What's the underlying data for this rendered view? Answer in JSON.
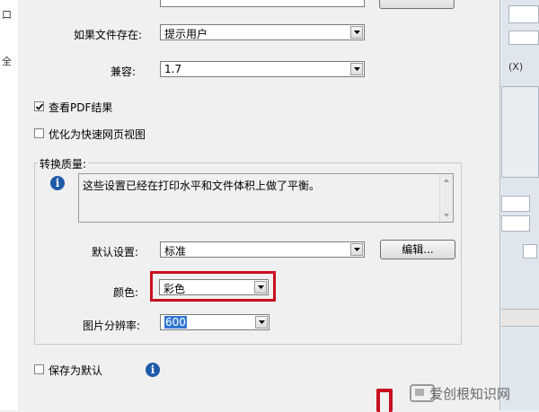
{
  "left_strip": {
    "glyphs": [
      "口",
      "全"
    ]
  },
  "dialog": {
    "if_file_exists": {
      "label": "如果文件存在:",
      "value": "提示用户"
    },
    "compat": {
      "label": "兼容:",
      "value": "1.7"
    },
    "view_pdf": {
      "label": "查看PDF结果",
      "checked": true
    },
    "optimize_web": {
      "label": "优化为快速网页视图",
      "checked": false
    },
    "quality_group": {
      "title": "转换质量:",
      "description": "这些设置已经在打印水平和文件体积上做了平衡。",
      "default_setting": {
        "label": "默认设置:",
        "value": "标准"
      },
      "edit_button": "编辑...",
      "color": {
        "label": "颜色:",
        "value": "彩色"
      },
      "resolution": {
        "label": "图片分辨率:",
        "value": "600"
      }
    },
    "save_default": {
      "label": "保存为默认",
      "checked": false
    }
  },
  "right_strip": {
    "fragment": "(X)"
  },
  "watermark": "爱创根知识网",
  "colors": {
    "highlight": "#c8101f",
    "info": "#1f5ba8",
    "selection": "#3377d3"
  },
  "icons": [
    "info-icon",
    "checkmark-icon",
    "chevron-down-icon",
    "watermark-logo-icon"
  ]
}
